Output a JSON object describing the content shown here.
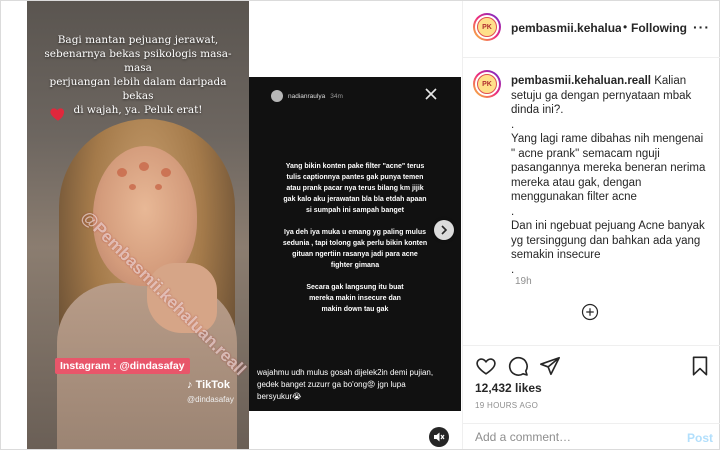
{
  "media": {
    "photo_caption": "Bagi mantan pejuang jerawat,\nsebenarnya bekas psikologis masa-masa\nperjuangan lebih dalam daripada bekas\ndi wajah, ya. Peluk erat!",
    "watermark": "@Pembasmii.kehaluan.reall",
    "instagram_tag": "Instagram : @dindasafay",
    "tiktok_label": "TikTok",
    "tiktok_user": "@dindasafay",
    "story": {
      "username": "nadianraulya",
      "time": "34m",
      "body": "Yang bikin konten pake filter \"acne\" terus\ntulis captionnya pantes gak punya temen\natau prank pacar nya terus bilang km jijik\ngak kalo aku jerawatan bla bla etdah apaan\nsi sumpah ini sampah banget\n\nIya deh iya muka u emang yg paling mulus\nsedunia , tapi tolong gak perlu bikin konten\ngituan ngertiin rasanya jadi para acne\nfighter gimana\n\nSecara gak langsung itu buat\nmereka makin insecure dan\nmakin down tau gak",
      "footer": "wajahmu udh mulus gosah dijelek2in demi pujian,\ngedek banget zuzurr ga bo'ong😡 jgn lupa\nbersyukur😭"
    }
  },
  "header": {
    "username": "pembasmii.kehaluan.reall",
    "separator": "•",
    "follow_label": "Following",
    "more_label": "···",
    "avatar_text": "PK"
  },
  "caption": {
    "username": "pembasmii.kehaluan.reall",
    "p1_text": "Kalian setuju ga dengan pernyataan mbak dinda ini?.",
    "p2": ".\nYang lagi rame dibahas nih mengenai \" acne prank\" semacam nguji pasangannya mereka beneran nerima mereka atau gak, dengan menggunakan filter acne\n.\nDan ini ngebuat pejuang Acne banyak yg tersinggung dan bahkan ada yang semakin insecure\n.",
    "time": "19h"
  },
  "stats": {
    "likes": "12,432 likes",
    "posted": "19 HOURS AGO"
  },
  "comment": {
    "placeholder": "Add a comment…",
    "post_label": "Post"
  },
  "colors": {
    "link_disabled": "#b2dffc",
    "muted": "#8e8e8e",
    "text": "#262626",
    "ig_tag": "#e8566a"
  },
  "icons": [
    "heart-icon",
    "comment-icon",
    "share-icon",
    "bookmark-icon",
    "plus-circle-icon",
    "chevron-right-icon",
    "mute-icon",
    "close-icon",
    "red-heart-icon"
  ]
}
